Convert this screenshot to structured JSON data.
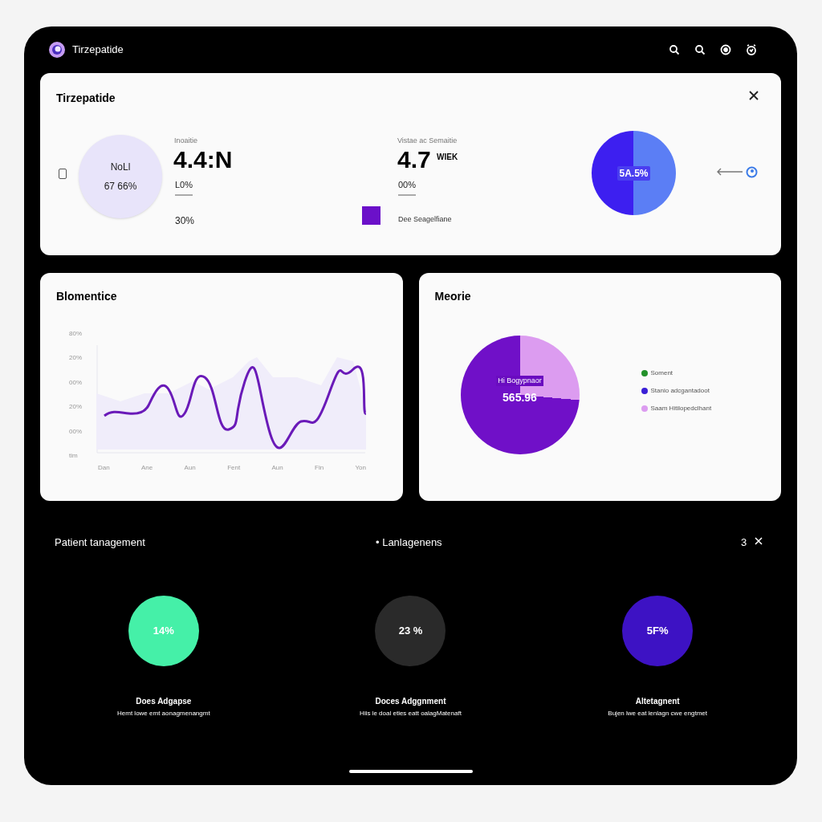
{
  "app": {
    "title": "Tirzepatide"
  },
  "summary": {
    "title": "Tirzepatide",
    "checked": false,
    "ring": {
      "label": "NoLl",
      "value": "67 66%"
    },
    "stat_1": {
      "label": "Inoaitie",
      "value": "4.4:N",
      "sub": "L0%",
      "note": "30%"
    },
    "stat_2": {
      "label": "Vistae ac Semaitie",
      "value": "4.7",
      "unit": "WIEK",
      "sub": "00%"
    },
    "legend": {
      "color": "#6b10c9",
      "label": "Dee Seagelfiane"
    },
    "pie": {
      "label": "5A.5%"
    }
  },
  "line_card": {
    "title": "Blomentice",
    "y_labels": [
      "80%",
      "20%",
      "00%",
      "20%",
      "00%",
      "tim"
    ],
    "x_labels": [
      "Dan",
      "Ane",
      "Aun",
      "Fent",
      "Aun",
      "Fin",
      "Yon"
    ]
  },
  "pie_card": {
    "title": "Meorie",
    "center_label": "Hi Bogypnaor",
    "center_value": "565.96",
    "legend": [
      {
        "label": "Soment",
        "color": "#22912a"
      },
      {
        "label": "Stanio adcgantadoot",
        "color": "#3a1fd6"
      },
      {
        "label": "Saam Hitilopedclhant",
        "color": "#dc9cf0"
      }
    ]
  },
  "management": {
    "title": "Patient tanagement",
    "center_title": "• Lanlagenens",
    "count": "3",
    "metrics": [
      {
        "value": "14%",
        "color": "#45f0a8",
        "title": "Does Adgapse",
        "subtitle": "Hemt lowe emt aonagmenangmt"
      },
      {
        "value": "23 %",
        "color": "#2a2a2a",
        "title": "Doces Adggnment",
        "subtitle": "Hiis le doal eties eatt oalagMatenaft"
      },
      {
        "value": "5F%",
        "color": "#3d12c4",
        "title": "Altetagnent",
        "subtitle": "Bujen lwe eat lenlagn cwe engtmet"
      }
    ]
  }
}
